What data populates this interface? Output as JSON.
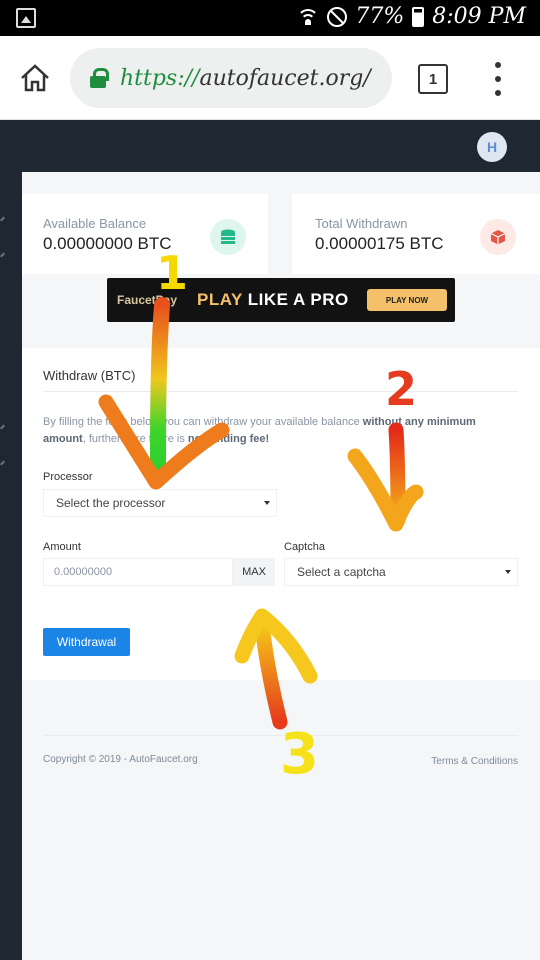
{
  "status_bar": {
    "battery": "77%",
    "time": "8:09 PM",
    "icons": [
      "image-icon",
      "wifi-icon",
      "do-not-disturb-icon",
      "battery-icon"
    ]
  },
  "browser": {
    "url_scheme": "https://",
    "url_host": "autofaucet.org/",
    "tab_count": "1",
    "icons": [
      "home-icon",
      "lock-icon",
      "tabs-icon",
      "more-vert-icon"
    ],
    "lock_color": "#1e8e3e"
  },
  "header": {
    "avatar_initial": "H",
    "bg_color": "#1f2733"
  },
  "stats": {
    "available_label": "Available Balance",
    "available_value": "0.00000000 BTC",
    "withdrawn_label": "Total Withdrawn",
    "withdrawn_value": "0.00000175 BTC",
    "icons": [
      "coins-icon",
      "box-icon"
    ]
  },
  "ad_banner": {
    "logo": "FaucetPay",
    "headline_a": "PLAY",
    "headline_b": " LIKE A PRO",
    "cta": "PLAY NOW"
  },
  "withdraw_form": {
    "title": "Withdraw (BTC)",
    "desc_intro": "By filling the form below you can withdraw your available balance ",
    "desc_bold_1": "without any minimum amount",
    "desc_mid": ", furthermore there is ",
    "desc_bold_2": "no sending fee!",
    "processor_label": "Processor",
    "processor_value": "Select the processor",
    "amount_label": "Amount",
    "amount_value": "0.00000000",
    "max_label": "MAX",
    "captcha_label": "Captcha",
    "captcha_value": "Select a captcha",
    "submit_label": "Withdrawal",
    "accent_color": "#1b84e7"
  },
  "footer": {
    "copyright": "Copyright © 2019 - AutoFaucet.org",
    "terms": "Terms & Conditions"
  },
  "annotations": {
    "labels": [
      "1",
      "2",
      "3"
    ],
    "colors": [
      "#f5d800",
      "#e53c1f",
      "#f5e21a"
    ]
  }
}
